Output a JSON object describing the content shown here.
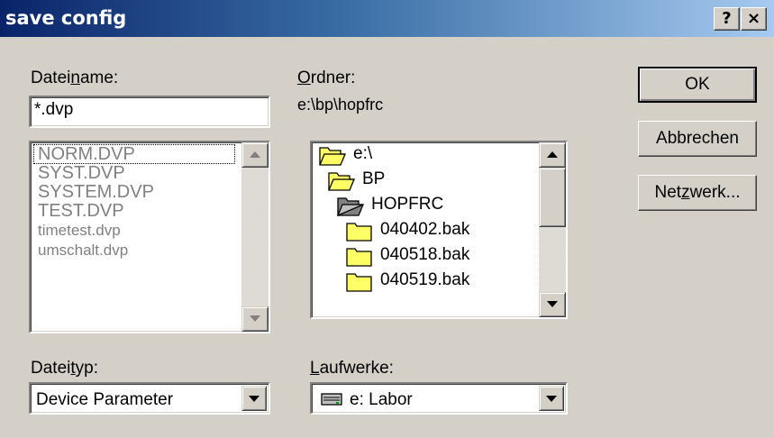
{
  "window": {
    "title": "save config",
    "help_label": "?",
    "close_label": "×"
  },
  "filename": {
    "label_pre": "Datei",
    "label_accel": "n",
    "label_post": "ame:",
    "value": "*.dvp",
    "files": [
      "NORM.DVP",
      "SYST.DVP",
      "SYSTEM.DVP",
      "TEST.DVP",
      "timetest.dvp",
      "umschalt.dvp"
    ]
  },
  "folder": {
    "label_accel": "O",
    "label_post": "rdner:",
    "path": "e:\\bp\\hopfrc",
    "tree": [
      {
        "name": "e:\\",
        "icon": "open-folder-icon"
      },
      {
        "name": "BP",
        "icon": "open-folder-icon"
      },
      {
        "name": "HOPFRC",
        "icon": "open-folder-selected-icon"
      },
      {
        "name": "040402.bak",
        "icon": "folder-icon"
      },
      {
        "name": "040518.bak",
        "icon": "folder-icon"
      },
      {
        "name": "040519.bak",
        "icon": "folder-icon"
      }
    ]
  },
  "filetype": {
    "label_pre": "Datei",
    "label_accel": "t",
    "label_post": "yp:",
    "selected": "Device Parameter"
  },
  "drives": {
    "label_accel": "L",
    "label_post": "aufwerke:",
    "selected": "e: Labor",
    "icon": "drive-icon"
  },
  "buttons": {
    "ok": "OK",
    "cancel": "Abbrechen",
    "network_pre": "Net",
    "network_accel": "z",
    "network_post": "werk..."
  },
  "colors": {
    "titlebar_start": "#0a246a",
    "titlebar_end": "#a6caf0",
    "face": "#d4d0c8",
    "disabled_text": "#808080",
    "folder_yellow": "#ffff66"
  }
}
